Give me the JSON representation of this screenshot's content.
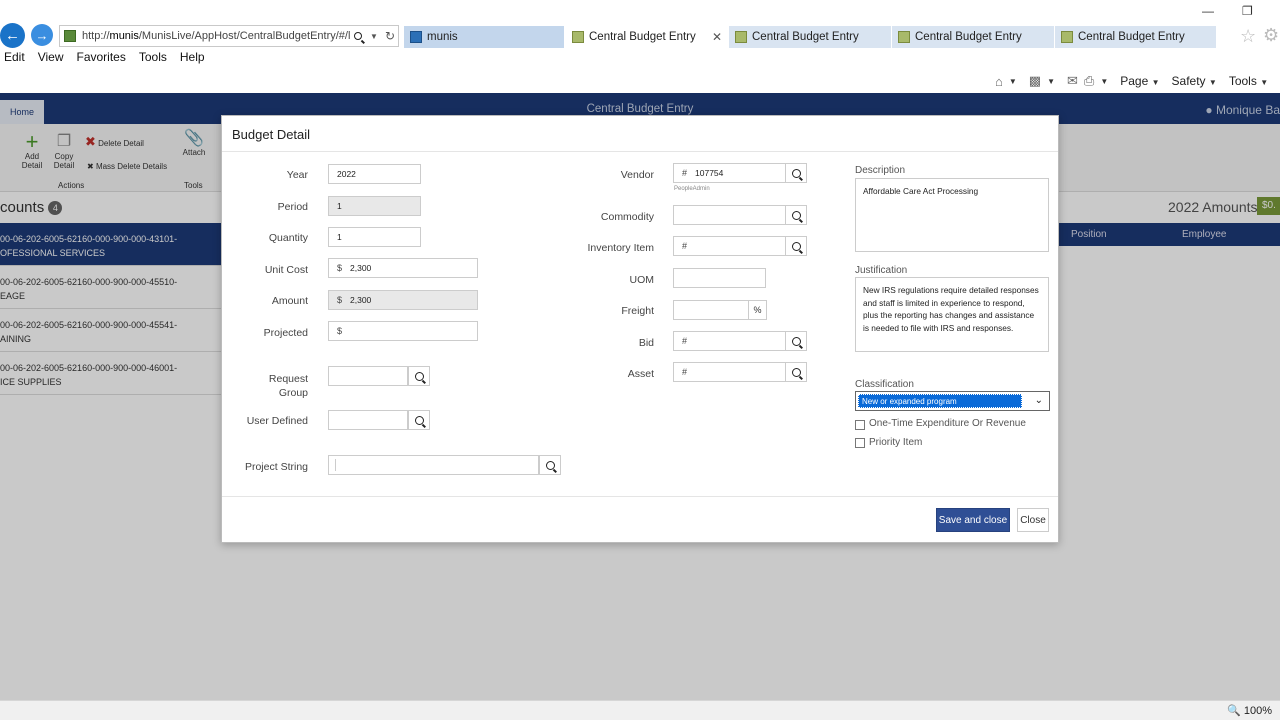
{
  "browser": {
    "url_prefix": "http://",
    "url_host": "munis",
    "url_rest": "/MunisLive/AppHost/CentralBudgetEntry/#/l",
    "tabs": [
      {
        "label": "munis"
      },
      {
        "label": "Central Budget Entry",
        "close": "✕"
      },
      {
        "label": "Central Budget Entry"
      },
      {
        "label": "Central Budget Entry"
      },
      {
        "label": "Central Budget Entry"
      }
    ],
    "menu": [
      "Edit",
      "View",
      "Favorites",
      "Tools",
      "Help"
    ],
    "commands": {
      "page": "Page",
      "safety": "Safety",
      "tools": "Tools"
    },
    "zoom": "100%"
  },
  "app": {
    "home_tab": "Home",
    "title": "Central Budget Entry",
    "user": "Monique Ba",
    "ribbon": {
      "add_detail": "Add Detail",
      "copy_detail": "Copy Detail",
      "delete_detail": "Delete Detail",
      "mass_delete": "Mass Delete Details",
      "actions_group": "Actions",
      "attach": "Attach",
      "tools_group": "Tools"
    },
    "accounts_title": "counts",
    "accounts_count": "4",
    "amounts_title": "2022 Amounts",
    "amount_badge": "$0.",
    "grid_columns": {
      "position": "Position",
      "employee": "Employee"
    },
    "accounts": [
      {
        "line1": "00-06-202-6005-62160-000-900-000-43101-",
        "line2": "OFESSIONAL SERVICES"
      },
      {
        "line1": "00-06-202-6005-62160-000-900-000-45510-",
        "line2": "EAGE"
      },
      {
        "line1": "00-06-202-6005-62160-000-900-000-45541-",
        "line2": "AINING"
      },
      {
        "line1": "00-06-202-6005-62160-000-900-000-46001-",
        "line2": "ICE SUPPLIES"
      }
    ]
  },
  "modal": {
    "title": "Budget Detail",
    "fields": {
      "year": {
        "label": "Year",
        "value": "2022"
      },
      "period": {
        "label": "Period",
        "value": "1"
      },
      "quantity": {
        "label": "Quantity",
        "value": "1"
      },
      "unit_cost": {
        "label": "Unit Cost",
        "prefix": "$",
        "value": "2,300"
      },
      "amount": {
        "label": "Amount",
        "prefix": "$",
        "value": "2,300"
      },
      "projected": {
        "label": "Projected",
        "prefix": "$",
        "value": ""
      },
      "request_group": {
        "label_line1": "Request",
        "label_line2": "Group",
        "value": ""
      },
      "user_defined": {
        "label": "User Defined",
        "value": ""
      },
      "project_string": {
        "label": "Project String",
        "value": ""
      },
      "vendor": {
        "label": "Vendor",
        "prefix": "#",
        "value": "107754",
        "note": "PeopleAdmin"
      },
      "commodity": {
        "label": "Commodity",
        "value": ""
      },
      "inventory_item": {
        "label": "Inventory Item",
        "prefix": "#",
        "value": ""
      },
      "uom": {
        "label": "UOM",
        "value": ""
      },
      "freight": {
        "label": "Freight",
        "suffix": "%",
        "value": ""
      },
      "bid": {
        "label": "Bid",
        "prefix": "#",
        "value": ""
      },
      "asset": {
        "label": "Asset",
        "prefix": "#",
        "value": ""
      }
    },
    "description": {
      "label": "Description",
      "value": "Affordable Care Act Processing"
    },
    "justification": {
      "label": "Justification",
      "value": "New IRS regulations require detailed responses and staff is limited in experience to respond, plus the reporting has changes and assistance is needed to file with IRS and responses."
    },
    "classification": {
      "label": "Classification",
      "selected": "New or expanded program"
    },
    "checkboxes": {
      "one_time": {
        "label": "One-Time Expenditure Or Revenue",
        "checked": false
      },
      "priority": {
        "label": "Priority Item",
        "checked": false
      }
    },
    "buttons": {
      "save": "Save and close",
      "close": "Close"
    }
  }
}
